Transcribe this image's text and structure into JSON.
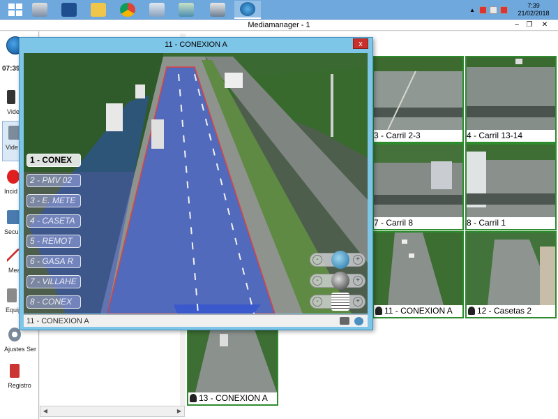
{
  "taskbar": {
    "icons": [
      "server-manager-icon",
      "powershell-icon",
      "file-explorer-icon",
      "chrome-icon",
      "remote-desktop-icon",
      "network-icon",
      "connection-icon",
      "mediamanager-icon"
    ]
  },
  "clock": {
    "time": "7:39",
    "date": "21/02/2018"
  },
  "window": {
    "title": "Mediamanager - 1",
    "minimize": "–",
    "maximize": "❐",
    "close": "✕"
  },
  "sidebar": {
    "time": "07:39",
    "items": [
      {
        "label": "Vide",
        "icon": "traffic-light-icon"
      },
      {
        "label": "Vide",
        "icon": "video-icon"
      },
      {
        "label": "Incid",
        "icon": "alarm-icon"
      },
      {
        "label": "Secu",
        "icon": "security-icon"
      },
      {
        "label": "Mea",
        "icon": "measure-icon"
      },
      {
        "label": "Equip",
        "icon": "equipment-icon"
      },
      {
        "label": "Ajustes Ser",
        "icon": "settings-icon"
      },
      {
        "label": "Registro",
        "icon": "registro-icon"
      }
    ]
  },
  "popup": {
    "title": "11 - CONEXION A",
    "close": "x",
    "status": "11 - CONEXION A",
    "presets": [
      "1 - CONEX",
      "2 - PMV 02",
      "3 - E. METE",
      "4 - CASETA",
      "5 - REMOT",
      "6 - GASA R",
      "7 - VILLAHE",
      "8 - CONEX"
    ],
    "active_preset": 0,
    "ptz_minus": "-",
    "ptz_plus": "+"
  },
  "grid": {
    "tiles": [
      {
        "caption": "3 - Carril 2-3",
        "camera_icon": false
      },
      {
        "caption": "4 - Carril 13-14",
        "camera_icon": false
      },
      {
        "caption": "7 - Carril 8",
        "camera_icon": false
      },
      {
        "caption": "8 - Carril 1",
        "camera_icon": false
      },
      {
        "caption": "11 - CONEXION A",
        "camera_icon": true
      },
      {
        "caption": "12 - Casetas 2",
        "camera_icon": true
      },
      {
        "caption": "13 - CONEXION A",
        "camera_icon": true
      }
    ]
  },
  "colors": {
    "taskbar": "#6fa8dc",
    "popup_frame": "#7ec6e8",
    "tile_border": "#2e8b2e",
    "close_red": "#c9302c",
    "overlay_blue": "#2a4fd8"
  }
}
